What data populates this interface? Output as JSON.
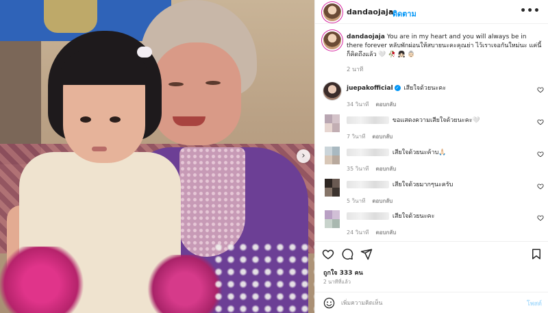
{
  "header": {
    "username": "dandaojaja",
    "separator": "•",
    "follow_label": "ติดตาม",
    "more_label": "•••"
  },
  "caption": {
    "username": "dandaojaja",
    "text": "You are in my heart and you will always be in there forever หลับพักผ่อนให้สบายนะคะคุณย่า ไว้เราเจอกันใหม่นะ แค่นี้ก็คิดถึงแล้ว 🤍 🥀 👧🏻 👵🏻",
    "time": "2 นาที"
  },
  "comments": [
    {
      "username": "juepakofficial",
      "verified": true,
      "text": "เสียใจด้วยนะคะ",
      "time": "34 วินาที",
      "reply": "ตอบกลับ"
    },
    {
      "username": "",
      "text": "ขอแสดงความเสียใจด้วยนะคะ🤍",
      "time": "7 วินาที",
      "reply": "ตอบกลับ"
    },
    {
      "username": "",
      "text": "เสียใจด้วยนะค้าบ🙏🏻",
      "time": "35 วินาที",
      "reply": "ตอบกลับ"
    },
    {
      "username": "",
      "text": "เสียใจด้วยมากๆนะครับ",
      "time": "5 วินาที",
      "reply": "ตอบกลับ"
    },
    {
      "username": "",
      "text": "เสียใจด้วยนะคะ",
      "time": "24 วินาที",
      "reply": "ตอบกลับ"
    }
  ],
  "actions": {
    "likes": "ถูกใจ 333 คน",
    "posted": "2 นาทีที่แล้ว"
  },
  "composer": {
    "placeholder": "เพิ่มความคิดเห็น",
    "post_label": "โพสต์"
  },
  "photo": {
    "next_icon": "chevron-right-icon",
    "next_glyph": "›"
  },
  "colors": {
    "accent": "#0095f6",
    "muted": "#8e8e8e",
    "post_disabled": "#b2dffc"
  }
}
